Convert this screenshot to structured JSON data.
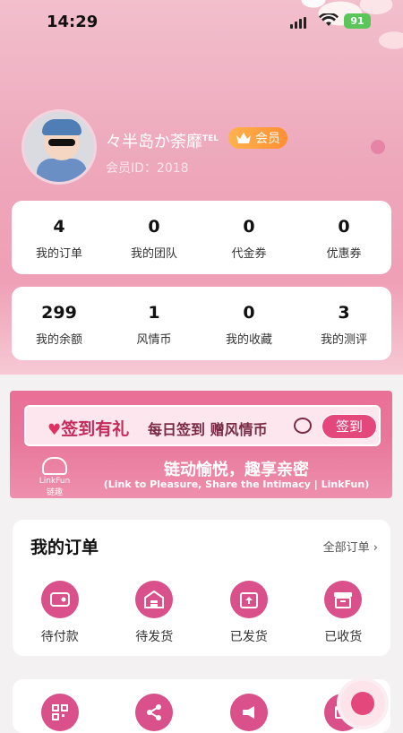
{
  "status_bar": {
    "time": "14:29",
    "battery": "91"
  },
  "profile": {
    "nickname": "々半岛か荼靡",
    "nickname_sup": "TEL",
    "vip_label": "会员",
    "member_id": "会员ID：2018"
  },
  "stats_row1": [
    {
      "value": "4",
      "label": "我的订单"
    },
    {
      "value": "0",
      "label": "我的团队"
    },
    {
      "value": "0",
      "label": "代金券"
    },
    {
      "value": "0",
      "label": "优惠券"
    }
  ],
  "stats_row2": [
    {
      "value": "299",
      "label": "我的余额"
    },
    {
      "value": "1",
      "label": "风情币"
    },
    {
      "value": "0",
      "label": "我的收藏"
    },
    {
      "value": "3",
      "label": "我的测评"
    }
  ],
  "banner": {
    "sign_title": "签到有礼",
    "sign_desc": "每日签到 赠风情币",
    "sign_button": "签到",
    "logo_en": "LinkFun",
    "logo_cn": "链趣",
    "slogan": "链动愉悦，趣享亲密",
    "slogan_en": "(Link to Pleasure, Share the Intimacy | LinkFun)"
  },
  "orders": {
    "title": "我的订单",
    "all_link": "全部订单 ›",
    "items": [
      {
        "label": "待付款",
        "icon": "wallet-icon"
      },
      {
        "label": "待发货",
        "icon": "warehouse-icon"
      },
      {
        "label": "已发货",
        "icon": "box-up-icon"
      },
      {
        "label": "已收货",
        "icon": "archive-box-icon"
      }
    ]
  },
  "more_icons": [
    "qr-code-icon",
    "share-icon",
    "megaphone-icon",
    "mail-icon"
  ],
  "colors": {
    "accent": "#d9508a",
    "header_pink": "#eea7bb",
    "vip_orange": "#ff8f33",
    "banner_pink": "#e8779b"
  }
}
